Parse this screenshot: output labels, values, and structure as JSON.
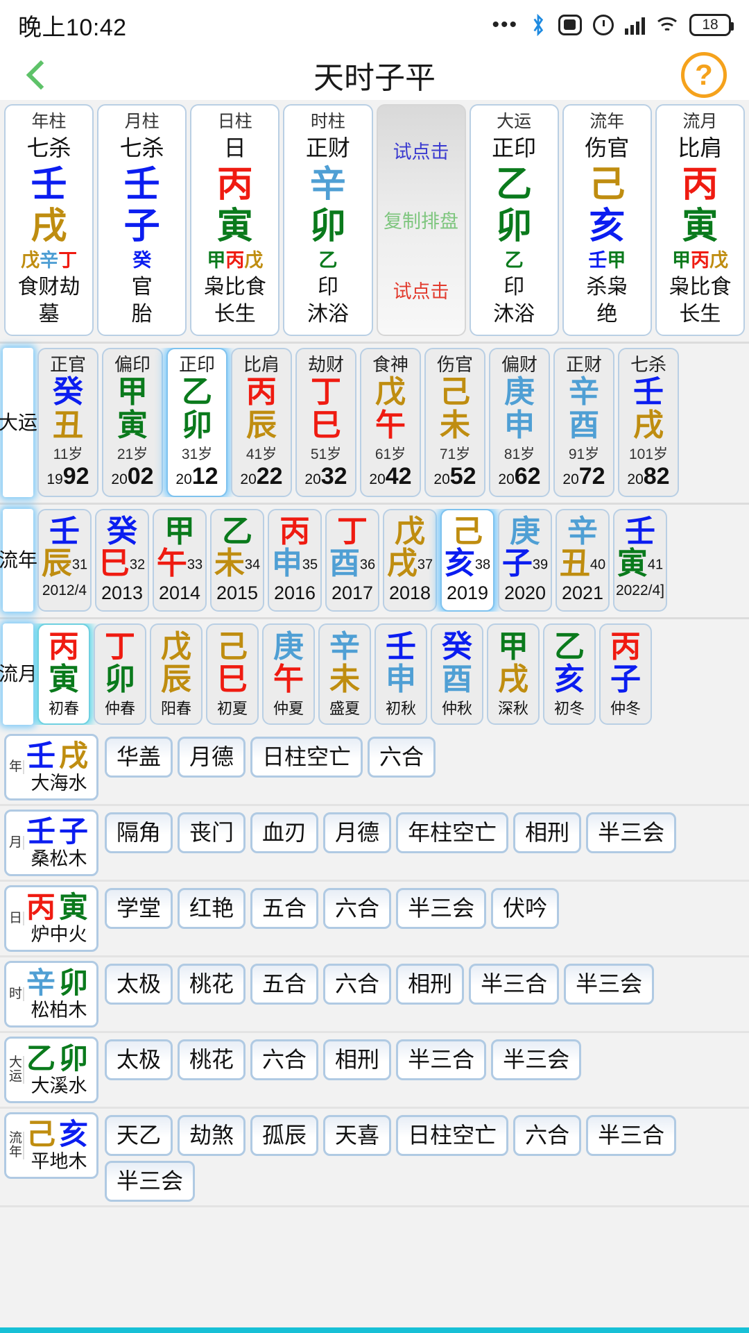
{
  "statusbar": {
    "time": "晚上10:42",
    "battery_percent": "18",
    "icons": [
      "more-dots-icon",
      "bluetooth-icon",
      "screen-record-icon",
      "alarm-icon",
      "signal-icon",
      "wifi-icon",
      "battery-icon"
    ]
  },
  "navbar": {
    "back": "‹",
    "title": "天时子平",
    "help": "?"
  },
  "pillars": {
    "cards": [
      {
        "head": "年柱",
        "god": "七杀",
        "stem": "壬",
        "stem_color": "blue",
        "branch": "戌",
        "branch_color": "gold",
        "hidden": [
          {
            "c": "戊",
            "color": "gold"
          },
          {
            "c": "辛",
            "color": "lblue"
          },
          {
            "c": "丁",
            "color": "red"
          }
        ],
        "ten_gods": "食财劫",
        "stage": "墓"
      },
      {
        "head": "月柱",
        "god": "七杀",
        "stem": "壬",
        "stem_color": "blue",
        "branch": "子",
        "branch_color": "blue",
        "hidden": [
          {
            "c": "癸",
            "color": "blue"
          }
        ],
        "ten_gods": "官",
        "stage": "胎"
      },
      {
        "head": "日柱",
        "god": "日",
        "stem": "丙",
        "stem_color": "red",
        "branch": "寅",
        "branch_color": "green",
        "hidden": [
          {
            "c": "甲",
            "color": "green"
          },
          {
            "c": "丙",
            "color": "red"
          },
          {
            "c": "戊",
            "color": "gold"
          }
        ],
        "ten_gods": "枭比食",
        "stage": "长生"
      },
      {
        "head": "时柱",
        "god": "正财",
        "stem": "辛",
        "stem_color": "lblue",
        "branch": "卯",
        "branch_color": "green",
        "hidden": [
          {
            "c": "乙",
            "color": "green"
          }
        ],
        "ten_gods": "印",
        "stage": "沐浴"
      }
    ],
    "copy_card": {
      "top": "试点击",
      "mid": "复制排盘",
      "bottom": "试点击"
    },
    "cards_right": [
      {
        "head": "大运",
        "god": "正印",
        "stem": "乙",
        "stem_color": "green",
        "branch": "卯",
        "branch_color": "green",
        "hidden": [
          {
            "c": "乙",
            "color": "green"
          }
        ],
        "ten_gods": "印",
        "stage": "沐浴"
      },
      {
        "head": "流年",
        "god": "伤官",
        "stem": "己",
        "stem_color": "gold",
        "branch": "亥",
        "branch_color": "blue",
        "hidden": [
          {
            "c": "壬",
            "color": "blue"
          },
          {
            "c": "甲",
            "color": "green"
          }
        ],
        "ten_gods": "杀枭",
        "stage": "绝"
      },
      {
        "head": "流月",
        "god": "比肩",
        "stem": "丙",
        "stem_color": "red",
        "branch": "寅",
        "branch_color": "green",
        "hidden": [
          {
            "c": "甲",
            "color": "green"
          },
          {
            "c": "丙",
            "color": "red"
          },
          {
            "c": "戊",
            "color": "gold"
          }
        ],
        "ten_gods": "枭比食",
        "stage": "长生"
      }
    ]
  },
  "dayun": {
    "label": "大运",
    "cells": [
      {
        "god": "正官",
        "stem": "癸",
        "stem_color": "blue",
        "branch": "丑",
        "branch_color": "gold",
        "age": "11岁",
        "year_prefix": "19",
        "year_suffix": "92",
        "selected": false
      },
      {
        "god": "偏印",
        "stem": "甲",
        "stem_color": "green",
        "branch": "寅",
        "branch_color": "green",
        "age": "21岁",
        "year_prefix": "20",
        "year_suffix": "02",
        "selected": false
      },
      {
        "god": "正印",
        "stem": "乙",
        "stem_color": "green",
        "branch": "卯",
        "branch_color": "green",
        "age": "31岁",
        "year_prefix": "20",
        "year_suffix": "12",
        "selected": true
      },
      {
        "god": "比肩",
        "stem": "丙",
        "stem_color": "red",
        "branch": "辰",
        "branch_color": "gold",
        "age": "41岁",
        "year_prefix": "20",
        "year_suffix": "22",
        "selected": false
      },
      {
        "god": "劫财",
        "stem": "丁",
        "stem_color": "red",
        "branch": "巳",
        "branch_color": "red",
        "age": "51岁",
        "year_prefix": "20",
        "year_suffix": "32",
        "selected": false
      },
      {
        "god": "食神",
        "stem": "戊",
        "stem_color": "gold",
        "branch": "午",
        "branch_color": "red",
        "age": "61岁",
        "year_prefix": "20",
        "year_suffix": "42",
        "selected": false
      },
      {
        "god": "伤官",
        "stem": "己",
        "stem_color": "gold",
        "branch": "未",
        "branch_color": "gold",
        "age": "71岁",
        "year_prefix": "20",
        "year_suffix": "52",
        "selected": false
      },
      {
        "god": "偏财",
        "stem": "庚",
        "stem_color": "lblue",
        "branch": "申",
        "branch_color": "lblue",
        "age": "81岁",
        "year_prefix": "20",
        "year_suffix": "62",
        "selected": false
      },
      {
        "god": "正财",
        "stem": "辛",
        "stem_color": "lblue",
        "branch": "酉",
        "branch_color": "lblue",
        "age": "91岁",
        "year_prefix": "20",
        "year_suffix": "72",
        "selected": false
      },
      {
        "god": "七杀",
        "stem": "壬",
        "stem_color": "blue",
        "branch": "戌",
        "branch_color": "gold",
        "age": "101岁",
        "year_prefix": "20",
        "year_suffix": "82",
        "selected": false
      }
    ]
  },
  "liunian": {
    "label": "流年",
    "cells": [
      {
        "stem": "壬",
        "stem_color": "blue",
        "branch": "辰",
        "branch_color": "gold",
        "age": "31",
        "year": "2012/4",
        "small": true,
        "selected": false
      },
      {
        "stem": "癸",
        "stem_color": "blue",
        "branch": "巳",
        "branch_color": "red",
        "age": "32",
        "year": "2013",
        "small": false,
        "selected": false
      },
      {
        "stem": "甲",
        "stem_color": "green",
        "branch": "午",
        "branch_color": "red",
        "age": "33",
        "year": "2014",
        "small": false,
        "selected": false
      },
      {
        "stem": "乙",
        "stem_color": "green",
        "branch": "未",
        "branch_color": "gold",
        "age": "34",
        "year": "2015",
        "small": false,
        "selected": false
      },
      {
        "stem": "丙",
        "stem_color": "red",
        "branch": "申",
        "branch_color": "lblue",
        "age": "35",
        "year": "2016",
        "small": false,
        "selected": false
      },
      {
        "stem": "丁",
        "stem_color": "red",
        "branch": "酉",
        "branch_color": "lblue",
        "age": "36",
        "year": "2017",
        "small": false,
        "selected": false
      },
      {
        "stem": "戊",
        "stem_color": "gold",
        "branch": "戌",
        "branch_color": "gold",
        "age": "37",
        "year": "2018",
        "small": false,
        "selected": false
      },
      {
        "stem": "己",
        "stem_color": "gold",
        "branch": "亥",
        "branch_color": "blue",
        "age": "38",
        "year": "2019",
        "small": false,
        "selected": true
      },
      {
        "stem": "庚",
        "stem_color": "lblue",
        "branch": "子",
        "branch_color": "blue",
        "age": "39",
        "year": "2020",
        "small": false,
        "selected": false
      },
      {
        "stem": "辛",
        "stem_color": "lblue",
        "branch": "丑",
        "branch_color": "gold",
        "age": "40",
        "year": "2021",
        "small": false,
        "selected": false
      },
      {
        "stem": "壬",
        "stem_color": "blue",
        "branch": "寅",
        "branch_color": "green",
        "age": "41",
        "year": "2022/4]",
        "small": true,
        "selected": false
      }
    ]
  },
  "liuyue": {
    "label": "流月",
    "cells": [
      {
        "stem": "丙",
        "stem_color": "red",
        "branch": "寅",
        "branch_color": "green",
        "season": "初春",
        "selected": true
      },
      {
        "stem": "丁",
        "stem_color": "red",
        "branch": "卯",
        "branch_color": "green",
        "season": "仲春",
        "selected": false
      },
      {
        "stem": "戊",
        "stem_color": "gold",
        "branch": "辰",
        "branch_color": "gold",
        "season": "阳春",
        "selected": false
      },
      {
        "stem": "己",
        "stem_color": "gold",
        "branch": "巳",
        "branch_color": "red",
        "season": "初夏",
        "selected": false
      },
      {
        "stem": "庚",
        "stem_color": "lblue",
        "branch": "午",
        "branch_color": "red",
        "season": "仲夏",
        "selected": false
      },
      {
        "stem": "辛",
        "stem_color": "lblue",
        "branch": "未",
        "branch_color": "gold",
        "season": "盛夏",
        "selected": false
      },
      {
        "stem": "壬",
        "stem_color": "blue",
        "branch": "申",
        "branch_color": "lblue",
        "season": "初秋",
        "selected": false
      },
      {
        "stem": "癸",
        "stem_color": "blue",
        "branch": "酉",
        "branch_color": "lblue",
        "season": "仲秋",
        "selected": false
      },
      {
        "stem": "甲",
        "stem_color": "green",
        "branch": "戌",
        "branch_color": "gold",
        "season": "深秋",
        "selected": false
      },
      {
        "stem": "乙",
        "stem_color": "green",
        "branch": "亥",
        "branch_color": "blue",
        "season": "初冬",
        "selected": false
      },
      {
        "stem": "丙",
        "stem_color": "red",
        "branch": "子",
        "branch_color": "blue",
        "season": "仲冬",
        "selected": false
      }
    ]
  },
  "shensha": {
    "rows": [
      {
        "label": "年",
        "stem": "壬",
        "stem_color": "blue",
        "branch": "戌",
        "branch_color": "gold",
        "nayin": "大海水",
        "tags": [
          "华盖",
          "月德",
          "日柱空亡",
          "六合"
        ]
      },
      {
        "label": "月",
        "stem": "壬",
        "stem_color": "blue",
        "branch": "子",
        "branch_color": "blue",
        "nayin": "桑松木",
        "tags": [
          "隔角",
          "丧门",
          "血刃",
          "月德",
          "年柱空亡",
          "相刑",
          "半三会"
        ]
      },
      {
        "label": "日",
        "stem": "丙",
        "stem_color": "red",
        "branch": "寅",
        "branch_color": "green",
        "nayin": "炉中火",
        "tags": [
          "学堂",
          "红艳",
          "五合",
          "六合",
          "半三会",
          "伏吟"
        ]
      },
      {
        "label": "时",
        "stem": "辛",
        "stem_color": "lblue",
        "branch": "卯",
        "branch_color": "green",
        "nayin": "松柏木",
        "tags": [
          "太极",
          "桃花",
          "五合",
          "六合",
          "相刑",
          "半三合",
          "半三会"
        ]
      },
      {
        "label": "大运",
        "stem": "乙",
        "stem_color": "green",
        "branch": "卯",
        "branch_color": "green",
        "nayin": "大溪水",
        "tags": [
          "太极",
          "桃花",
          "六合",
          "相刑",
          "半三合",
          "半三会"
        ]
      },
      {
        "label": "流年",
        "stem": "己",
        "stem_color": "gold",
        "branch": "亥",
        "branch_color": "blue",
        "nayin": "平地木",
        "tags": [
          "天乙",
          "劫煞",
          "孤辰",
          "天喜",
          "日柱空亡",
          "六合",
          "半三合",
          "半三会"
        ]
      }
    ]
  }
}
